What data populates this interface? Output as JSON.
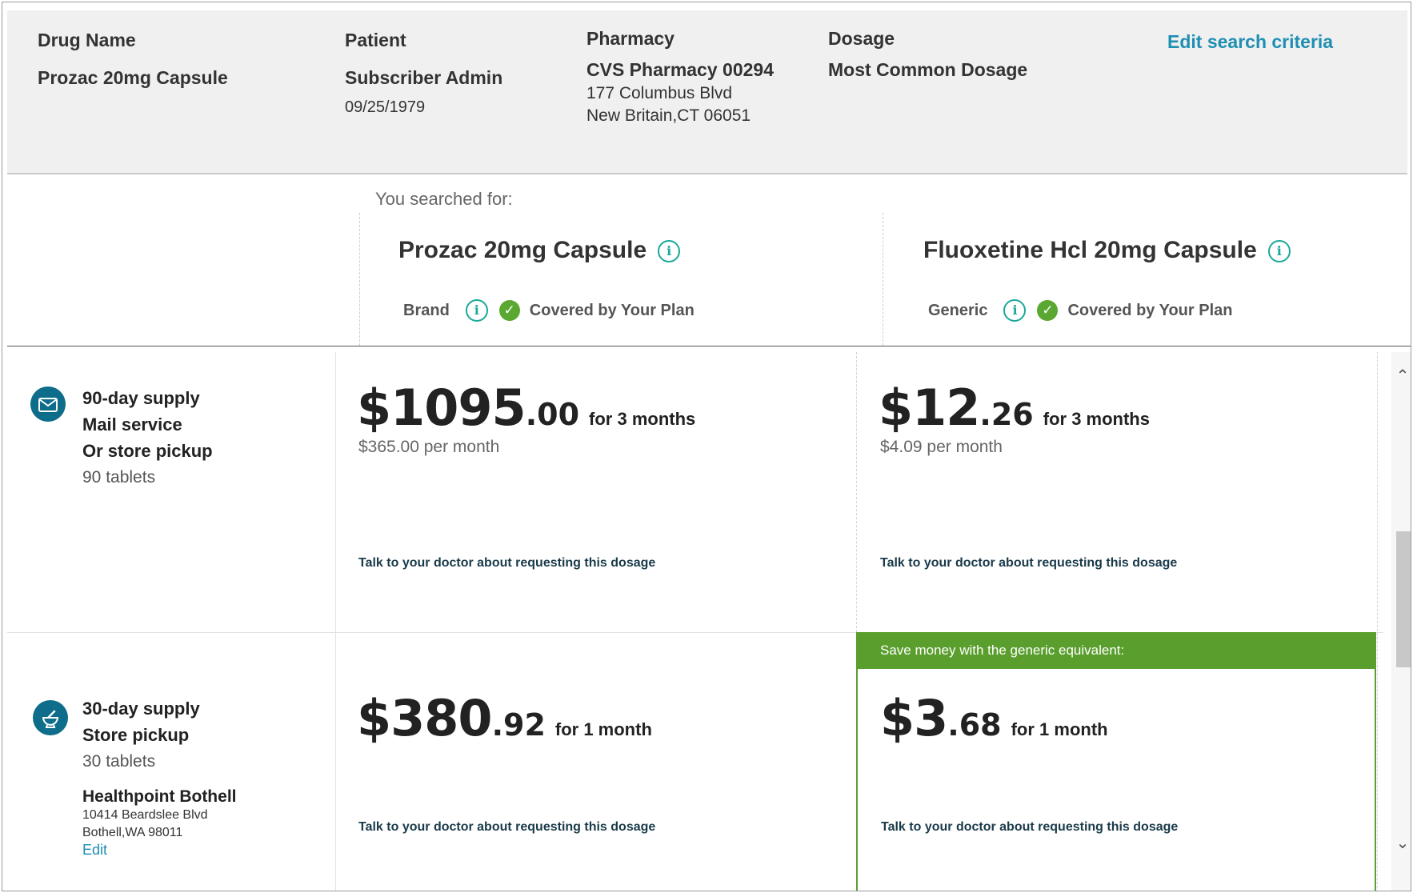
{
  "summary": {
    "drug_label": "Drug Name",
    "drug_value": "Prozac 20mg Capsule",
    "patient_label": "Patient",
    "patient_name": "Subscriber Admin",
    "patient_dob": "09/25/1979",
    "pharmacy_label": "Pharmacy",
    "pharmacy_name": "CVS Pharmacy 00294",
    "pharmacy_address1": "177 Columbus Blvd",
    "pharmacy_address2": "New Britain,CT 06051",
    "dosage_label": "Dosage",
    "dosage_value": "Most Common Dosage",
    "edit_link": "Edit search criteria"
  },
  "compare": {
    "searched_label": "You searched for:",
    "drugs": [
      {
        "name": "Prozac 20mg Capsule",
        "type": "Brand",
        "coverage": "Covered by Your Plan"
      },
      {
        "name": "Fluoxetine Hcl 20mg Capsule",
        "type": "Generic",
        "coverage": "Covered by Your Plan"
      }
    ]
  },
  "rows": [
    {
      "icon": "mail-icon",
      "lines": [
        "90-day supply",
        "Mail service",
        "Or store pickup"
      ],
      "quantity": "90 tablets",
      "prices": [
        {
          "dollars": "$1095",
          "cents": ".00",
          "period": "for 3 months",
          "per_month": "$365.00 per month",
          "note": "Talk to your doctor about requesting this dosage"
        },
        {
          "dollars": "$12",
          "cents": ".26",
          "period": "for 3 months",
          "per_month": "$4.09 per month",
          "note": "Talk to your doctor about requesting this dosage"
        }
      ]
    },
    {
      "icon": "pharmacy-mortar-icon",
      "lines": [
        "30-day supply",
        "Store pickup"
      ],
      "quantity": "30 tablets",
      "store": {
        "name": "Healthpoint Bothell",
        "address1": "10414 Beardslee Blvd",
        "address2": "Bothell,WA 98011",
        "edit": "Edit"
      },
      "prices": [
        {
          "dollars": "$380",
          "cents": ".92",
          "period": "for 1 month",
          "note": "Talk to your doctor about requesting this dosage"
        },
        {
          "dollars": "$3",
          "cents": ".68",
          "period": "for 1 month",
          "note": "Talk to your doctor about requesting this dosage",
          "banner": "Save money with the generic equivalent:"
        }
      ]
    }
  ],
  "colors": {
    "accent": "#1e8fb3",
    "icon_bg": "#0d6d8a",
    "covered": "#5aa832",
    "save_banner": "#5a9e2d"
  },
  "icons": {
    "info": "info-icon",
    "check": "check-icon",
    "scroll_up": "chevron-up-icon",
    "scroll_down": "chevron-down-icon"
  }
}
